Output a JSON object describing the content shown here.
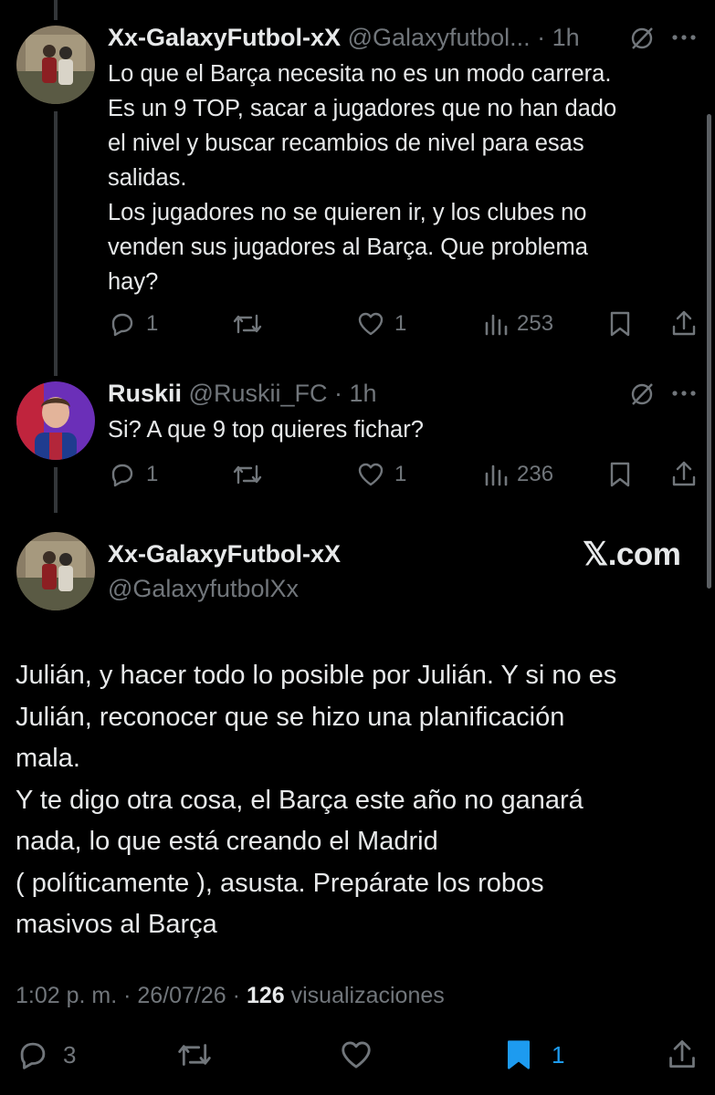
{
  "thread": [
    {
      "display_name": "Xx-GalaxyFutbol-xX",
      "handle": "@Galaxyfutbol...",
      "time": "· 1h",
      "lines": [
        "Lo que el Barça necesita no es un modo carrera.",
        "Es un 9 TOP, sacar a jugadores que no han dado",
        "el nivel y buscar recambios de nivel para esas",
        "salidas.",
        "Los jugadores no se quieren ir, y los clubes no",
        "venden sus jugadores al Barça. Que problema",
        "hay?"
      ],
      "replies": "1",
      "likes": "1",
      "views": "253"
    },
    {
      "display_name": "Ruskii",
      "handle": "@Ruskii_FC",
      "time": "· 1h",
      "lines": [
        "Si? A que 9 top quieres fichar?"
      ],
      "replies": "1",
      "likes": "1",
      "views": "236"
    }
  ],
  "main": {
    "display_name": "Xx-GalaxyFutbol-xX",
    "handle": "@GalaxyfutbolXx",
    "brand": "𝕏.com",
    "lines": [
      "Julián, y hacer todo lo posible por Julián. Y si no es",
      "Julián, reconocer que se hizo una planificación",
      "mala.",
      "Y te digo otra cosa, el Barça este año no ganará",
      "nada, lo que está creando el Madrid",
      "( políticamente ), asusta. Prepárate los robos",
      "masivos al Barça"
    ],
    "timestamp": "1:02 p. m. · 26/07/26 ·",
    "views_count": "126",
    "views_label": "visualizaciones",
    "replies": "3",
    "bookmarks": "1"
  },
  "colors": {
    "background": "#000000",
    "text": "#e7e9ea",
    "muted": "#71767b",
    "bookmark_active": "#1d9bf0"
  },
  "icons": [
    "reply-icon",
    "retweet-icon",
    "like-icon",
    "views-icon",
    "bookmark-icon",
    "share-icon",
    "grok-icon",
    "more-icon"
  ]
}
